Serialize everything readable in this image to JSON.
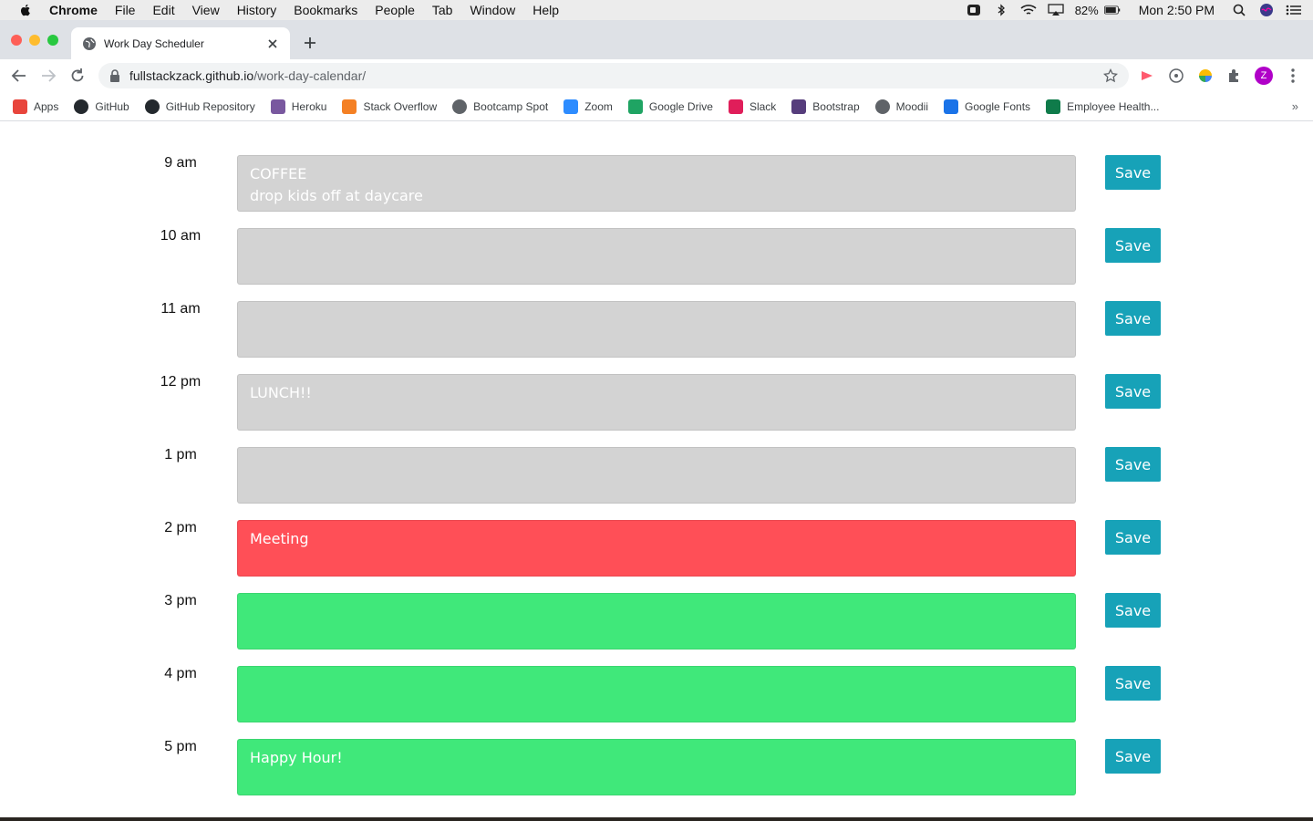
{
  "menubar": {
    "app": "Chrome",
    "items": [
      "File",
      "Edit",
      "View",
      "History",
      "Bookmarks",
      "People",
      "Tab",
      "Window",
      "Help"
    ],
    "battery": "82%",
    "clock": "Mon 2:50 PM"
  },
  "tab": {
    "title": "Work Day Scheduler"
  },
  "omnibox": {
    "host": "fullstackzack.github.io",
    "path": "/work-day-calendar/"
  },
  "profile": {
    "initial": "Z"
  },
  "bookmarks": [
    {
      "label": "Apps",
      "icon": "apps-grid-icon",
      "color": "#e8453c"
    },
    {
      "label": "GitHub",
      "icon": "github-icon",
      "color": "#24292e"
    },
    {
      "label": "GitHub Repository",
      "icon": "github-icon",
      "color": "#24292e"
    },
    {
      "label": "Heroku",
      "icon": "heroku-icon",
      "color": "#79589f"
    },
    {
      "label": "Stack Overflow",
      "icon": "stackoverflow-icon",
      "color": "#f48024"
    },
    {
      "label": "Bootcamp Spot",
      "icon": "globe-icon",
      "color": "#5f6368"
    },
    {
      "label": "Zoom",
      "icon": "zoom-icon",
      "color": "#2d8cff"
    },
    {
      "label": "Google Drive",
      "icon": "google-drive-icon",
      "color": "#1fa463"
    },
    {
      "label": "Slack",
      "icon": "slack-icon",
      "color": "#e01e5a"
    },
    {
      "label": "Bootstrap",
      "icon": "bootstrap-icon",
      "color": "#563d7c"
    },
    {
      "label": "Moodii",
      "icon": "globe-icon",
      "color": "#5f6368"
    },
    {
      "label": "Google Fonts",
      "icon": "google-fonts-icon",
      "color": "#1a73e8"
    },
    {
      "label": "Employee Health...",
      "icon": "forms-icon",
      "color": "#0f7b4a"
    }
  ],
  "colors": {
    "past": "#d3d3d3",
    "present": "#ff4f57",
    "future": "#40e87a",
    "save": "#17a2b8"
  },
  "schedule": [
    {
      "hour": "9 am",
      "text": "COFFEE\ndrop kids off at daycare",
      "state": "past",
      "save_label": "Save"
    },
    {
      "hour": "10 am",
      "text": "",
      "state": "past",
      "save_label": "Save"
    },
    {
      "hour": "11 am",
      "text": "",
      "state": "past",
      "save_label": "Save"
    },
    {
      "hour": "12 pm",
      "text": "LUNCH!!",
      "state": "past",
      "save_label": "Save"
    },
    {
      "hour": "1 pm",
      "text": "",
      "state": "past",
      "save_label": "Save"
    },
    {
      "hour": "2 pm",
      "text": "Meeting",
      "state": "present",
      "save_label": "Save"
    },
    {
      "hour": "3 pm",
      "text": "",
      "state": "future",
      "save_label": "Save"
    },
    {
      "hour": "4 pm",
      "text": "",
      "state": "future",
      "save_label": "Save"
    },
    {
      "hour": "5 pm",
      "text": "Happy Hour!",
      "state": "future",
      "save_label": "Save"
    }
  ]
}
